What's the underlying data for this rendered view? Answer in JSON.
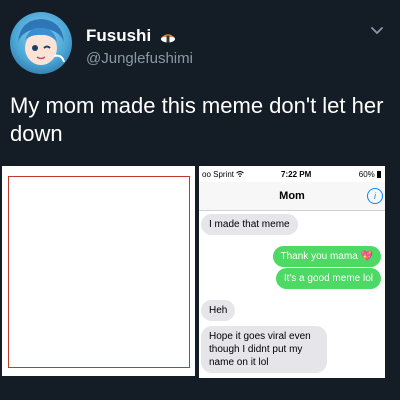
{
  "tweet": {
    "display_name": "Fusushi",
    "handle": "@Junglefushimi",
    "text": "My mom made this meme don't let her down"
  },
  "phone": {
    "carrier": "oo Sprint",
    "time": "7:22 PM",
    "battery": "60%",
    "contact": "Mom",
    "info_glyph": "i",
    "messages": [
      {
        "from": "mom",
        "text": "I made that meme"
      },
      {
        "from": "me",
        "text": "Thank you mama 💖"
      },
      {
        "from": "me",
        "text": "It's a good meme lol"
      },
      {
        "from": "mom",
        "text": "Heh"
      },
      {
        "from": "mom",
        "text": "Hope it goes viral even though I didnt put my name on it lol"
      }
    ]
  },
  "colors": {
    "background": "#141d26",
    "handle": "#8899a6",
    "incoming_bubble": "#e5e5ea",
    "outgoing_bubble": "#4cd964",
    "frame": "#c0392b"
  },
  "icons": [
    "avatar",
    "sushi-badge-icon",
    "chevron-down-icon",
    "wifi-icon",
    "battery-icon",
    "info-icon"
  ]
}
